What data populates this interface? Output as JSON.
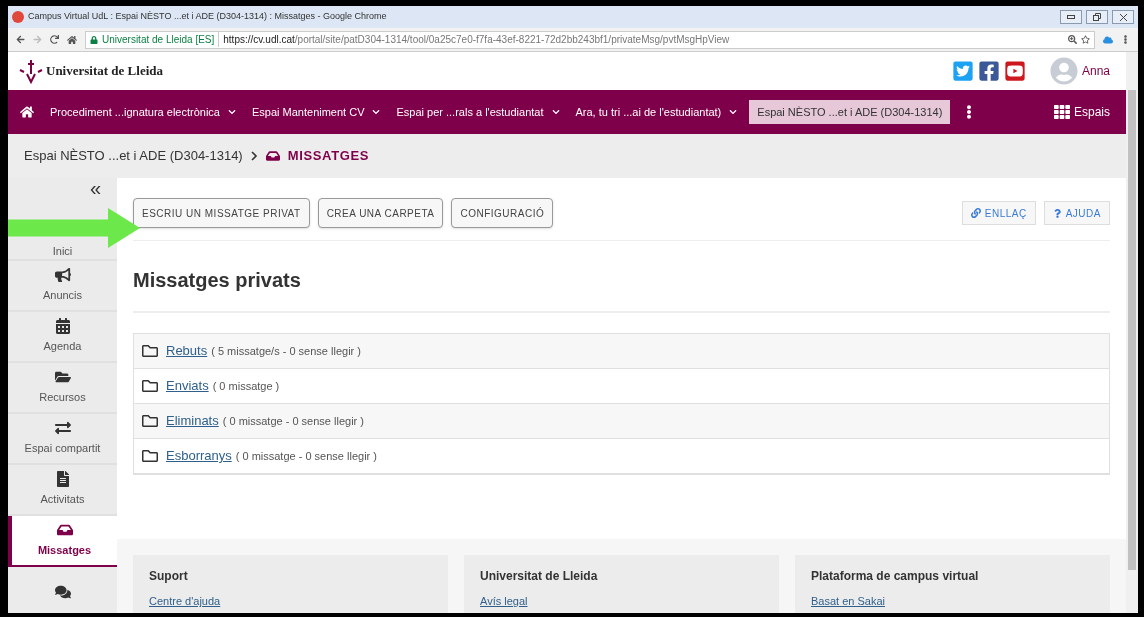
{
  "window": {
    "title": "Campus Virtual UdL : Espai NÈSTO ...et i ADE (D304-1314) : Missatges - Google Chrome"
  },
  "address_bar": {
    "site": "Universitat de Lleida [ES]",
    "url_host": "https://cv.udl.cat",
    "url_path": "/portal/site/patD304-1314/tool/0a25c7e0-f7fa-43ef-8221-72d2bb243bf1/privateMsg/pvtMsgHpView"
  },
  "header": {
    "logo_text": "Universitat de Lleida",
    "user": "Anna"
  },
  "nav": {
    "items": [
      {
        "label": "Procediment ...ignatura electrònica",
        "selected": false,
        "dropdown": true
      },
      {
        "label": "Espai Manteniment CV",
        "selected": false,
        "dropdown": true
      },
      {
        "label": "Espai per ...rals a l'estudiantat",
        "selected": false,
        "dropdown": true
      },
      {
        "label": "Ara, tu tri ...ai de l'estudiantat)",
        "selected": false,
        "dropdown": true
      },
      {
        "label": "Espai NÈSTO ...et i ADE (D304-1314)",
        "selected": true,
        "dropdown": false
      }
    ],
    "spaces": "Espais"
  },
  "breadcrumb": {
    "site": "Espai NÈSTO ...et i ADE (D304-1314)",
    "tool": "MISSATGES"
  },
  "sidebar": {
    "collapse": "«",
    "items": [
      {
        "kind": "covered",
        "label": "Inici",
        "selected": false
      },
      {
        "kind": "megaphone",
        "label": "Anuncis",
        "selected": false
      },
      {
        "kind": "calendar",
        "label": "Agenda",
        "selected": false
      },
      {
        "kind": "folder",
        "label": "Recursos",
        "selected": false
      },
      {
        "kind": "exchange",
        "label": "Espai compartit",
        "selected": false
      },
      {
        "kind": "file",
        "label": "Activitats",
        "selected": false
      },
      {
        "kind": "inbox",
        "label": "Missatges",
        "selected": true
      },
      {
        "kind": "comments",
        "selected": false
      }
    ]
  },
  "toolbar": {
    "buttons": [
      "ESCRIU UN MISSATGE PRIVAT",
      "CREA UNA CARPETA",
      "CONFIGURACIÓ"
    ],
    "link": "ENLLAÇ",
    "help": "AJUDA"
  },
  "page_title": "Missatges privats",
  "folders": [
    {
      "name": "Rebuts",
      "info": "( 5 missatge/s - 0 sense llegir )"
    },
    {
      "name": "Enviats",
      "info": "( 0 missatge )"
    },
    {
      "name": "Eliminats",
      "info": "( 0 missatge - 0 sense llegir )"
    },
    {
      "name": "Esborranys",
      "info": "( 0 missatge - 0 sense llegir )"
    }
  ],
  "footer": [
    {
      "title": "Suport",
      "link": "Centre d'ajuda"
    },
    {
      "title": "Universitat de Lleida",
      "link": "Avís legal"
    },
    {
      "title": "Plataforma de campus virtual",
      "link": "Basat en Sakai"
    }
  ]
}
